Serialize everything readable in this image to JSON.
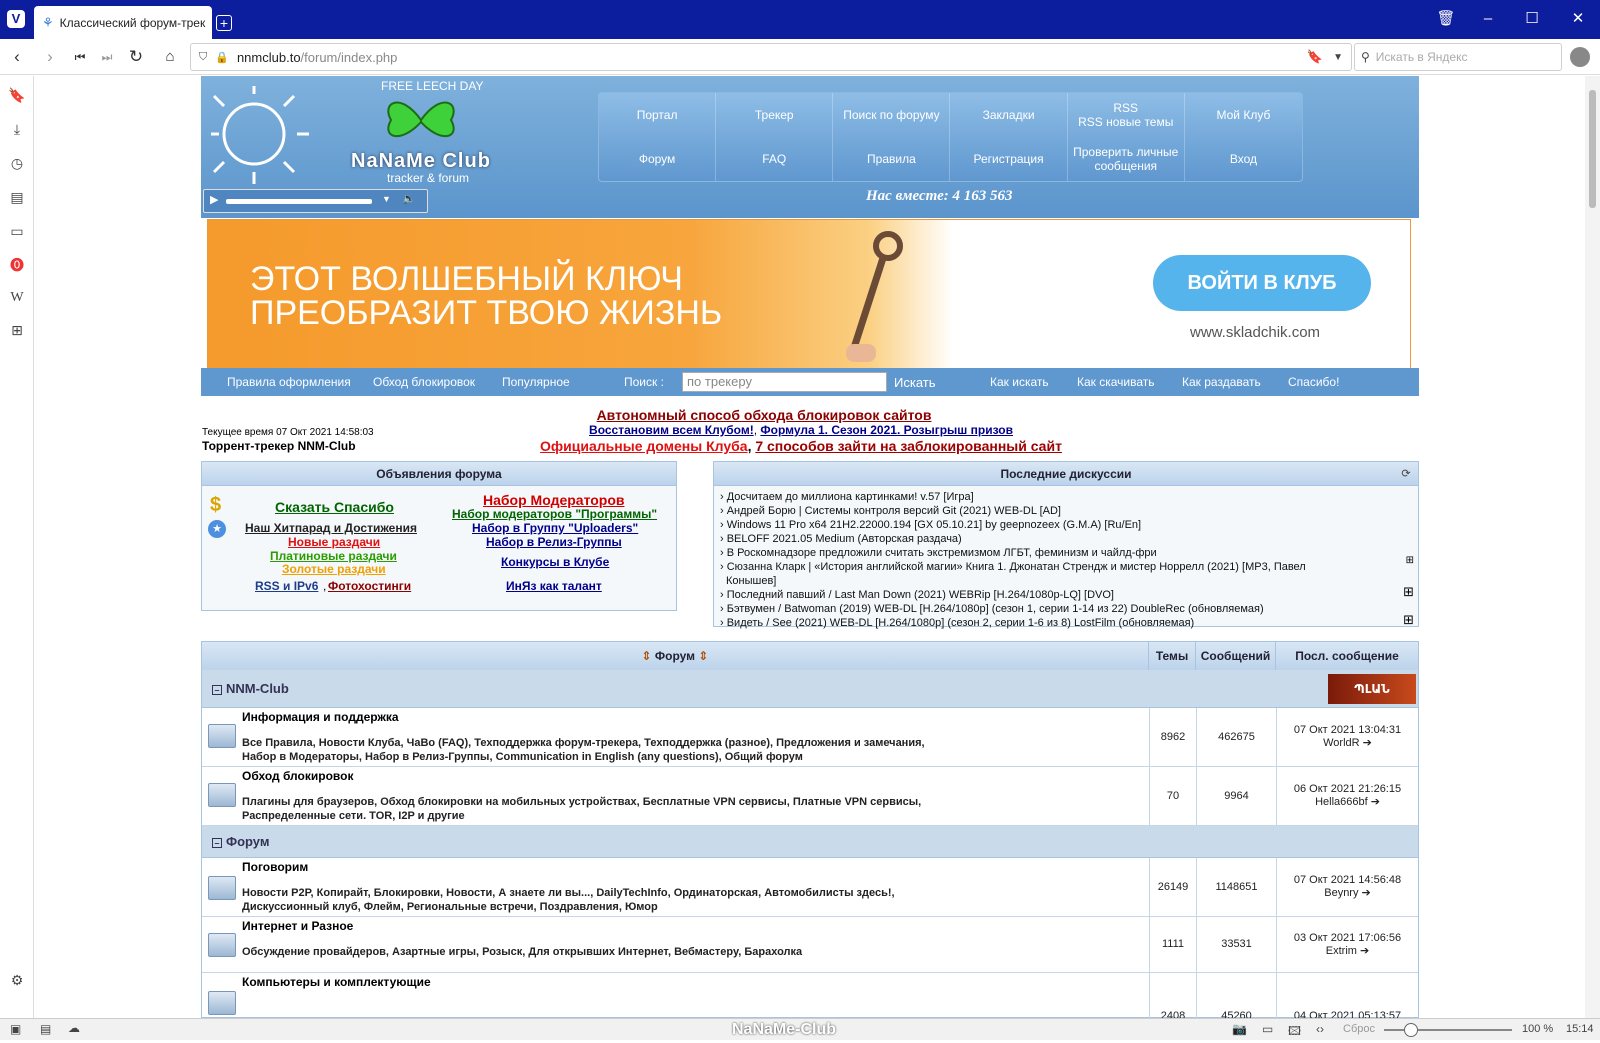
{
  "browser": {
    "tab_title": "Классический форум-трек",
    "url_domain": "nnmclub.to",
    "url_path": "/forum/index.php",
    "search_placeholder": "Искать в Яндекс"
  },
  "status": {
    "watermark": "NaNaMe-Club",
    "reset_label": "Сброс",
    "zoom": "100 %",
    "clock": "15:14"
  },
  "header": {
    "leech_day": "FREE LEECH DAY",
    "logo": "NaNaMe Club",
    "logo_sub": "tracker & forum",
    "together": "Нас вместе: 4 163 563",
    "nav": [
      "Портал",
      "Трекер",
      "Поиск по форуму",
      "Закладки",
      "RSS\nRSS новые темы",
      "Мой Клуб",
      "Форум",
      "FAQ",
      "Правила",
      "Регистрация",
      "Проверить личные сообщения",
      "Вход"
    ]
  },
  "banner": {
    "line1": "ЭТОТ ВОЛШЕБНЫЙ КЛЮЧ",
    "line2": "ПРЕОБРАЗИТ ТВОЮ ЖИЗНЬ",
    "button": "ВОЙТИ В КЛУБ",
    "url": "www.skladchik.com"
  },
  "linkbar": {
    "rules": "Правила оформления",
    "bypass": "Обход блокировок",
    "popular": "Популярное",
    "search_label": "Поиск :",
    "search_value": "по трекеру",
    "search_btn": "Искать",
    "how_search": "Как искать",
    "how_download": "Как скачивать",
    "how_seed": "Как раздавать",
    "thanks": "Спасибо!"
  },
  "info": {
    "ticker1": "Автономный способ обхода блокировок сайтов",
    "ticker2a": "Восстановим всем Клубом!",
    "ticker2b": "Формула 1. Сезон 2021. Розыгрыш призов",
    "ticker3a": "Официальные домены Клуба",
    "ticker3b": "7 способов зайти на заблокированный сайт",
    "current_time": "Текущее время 07 Окт 2021 14:58:03",
    "tracker_name": "Торрент-трекер NNM-Club"
  },
  "announce": {
    "title": "Объявления форума",
    "say_thanks": "Сказать Спасибо",
    "hitparade": "Наш Хитпарад и Достижения",
    "new": "Новые раздачи",
    "platinum": "Платиновые раздачи",
    "gold": "Золотые раздачи",
    "rss": "RSS и IPv6",
    "photo": "Фотохостинги",
    "moderators": "Набор Модераторов",
    "mod_programs": "Набор модераторов \"Программы\"",
    "uploaders": "Набор в Группу \"Uploaders\"",
    "release": "Набор в Релиз-Группы",
    "contests": "Конкурсы в Клубе",
    "inyaz": "ИнЯз как талант"
  },
  "recent": {
    "title": "Последние дискуссии",
    "items": [
      "› Досчитаем до миллиона картинками! v.57 [Игра]",
      "› Андрей Борю | Системы контроля версий Git (2021) WEB-DL [AD]",
      "› Windows 11 Pro x64 21H2.22000.194 [GX 05.10.21] by geepnozeex (G.M.A) [Ru/En]",
      "› BELOFF 2021.05 Medium (Авторская раздача)",
      "› В Роскомнадзоре предложили считать экстремизмом ЛГБТ, феминизм и чайлд-фри",
      "› Сюзанна Кларк | «История английской магии» Книга 1. Джонатан Стрендж и мистер Норрелл (2021) [MP3, Павел",
      "Конышев]",
      "› Последний павший / Last Man Down (2021) WEBRip [H.264/1080p-LQ] [DVO]",
      "› Бэтвумен / Batwoman (2019) WEB-DL [H.264/1080p] (сезон 1, серии 1-14 из 22) DoubleRec (обновляемая)",
      "› Видеть / See (2021) WEB-DL [H.264/1080p] (сезон 2, серии 1-6 из 8) LostFilm (обновляемая)"
    ]
  },
  "forum": {
    "col_forum": "Форум",
    "col_topics": "Темы",
    "col_posts": "Сообщений",
    "col_last": "Посл. сообщение",
    "cat1": "NNM-Club",
    "cat2": "Форум",
    "rows": [
      {
        "name": "Информация и поддержка",
        "sub1": "Все Правила,  Новости Клуба,  ЧаВо (FAQ),  Техподдержка форум-трекера,  Техподдержка (разное),  Предложения и замечания,",
        "sub2": "Набор в Модераторы,  Набор в Релиз-Группы,  Communication in English (any questions),  Общий форум",
        "topics": "8962",
        "posts": "462675",
        "last_date": "07 Окт 2021 13:04:31",
        "last_user": "WorldR"
      },
      {
        "name": "Обход блокировок",
        "sub1": "Плагины для браузеров,  Обход блокировки на мобильных устройствах,  Бесплатные VPN сервисы,  Платные VPN сервисы,",
        "sub2": "Распределенные сети. TOR, I2P и другие",
        "topics": "70",
        "posts": "9964",
        "last_date": "06 Окт 2021 21:26:15",
        "last_user": "Hella666bf"
      },
      {
        "name": "Поговорим",
        "sub1": "Новости P2P, Копирайт, Блокировки,  Новости,  А знаете ли вы...,  DailyTechInfo,  Ординаторская,  Автомобилисты здесь!,",
        "sub2": "Дискуссионный клуб,  Флейм,  Региональные встречи,  Поздравления,  Юмор",
        "topics": "26149",
        "posts": "1148651",
        "last_date": "07 Окт 2021 14:56:48",
        "last_user": "Beynry"
      },
      {
        "name": "Интернет и Разное",
        "sub1": "Обсуждение провайдеров,  Азартные игры,  Розыск,  Для открывших Интернет,  Вебмастеру,  Барахолка",
        "sub2": "",
        "topics": "1111",
        "posts": "33531",
        "last_date": "03 Окт 2021 17:06:56",
        "last_user": "Extrim"
      },
      {
        "name": "Компьютеры и комплектующие",
        "sub1": "",
        "sub2": "",
        "topics": "2408",
        "posts": "45260",
        "last_date": "04 Окт 2021 05:13:57",
        "last_user": ""
      }
    ]
  },
  "colors": {
    "header_blue": "#5f97cf",
    "titlebar": "#0c1e9e",
    "banner_orange": "#f59a2c"
  }
}
